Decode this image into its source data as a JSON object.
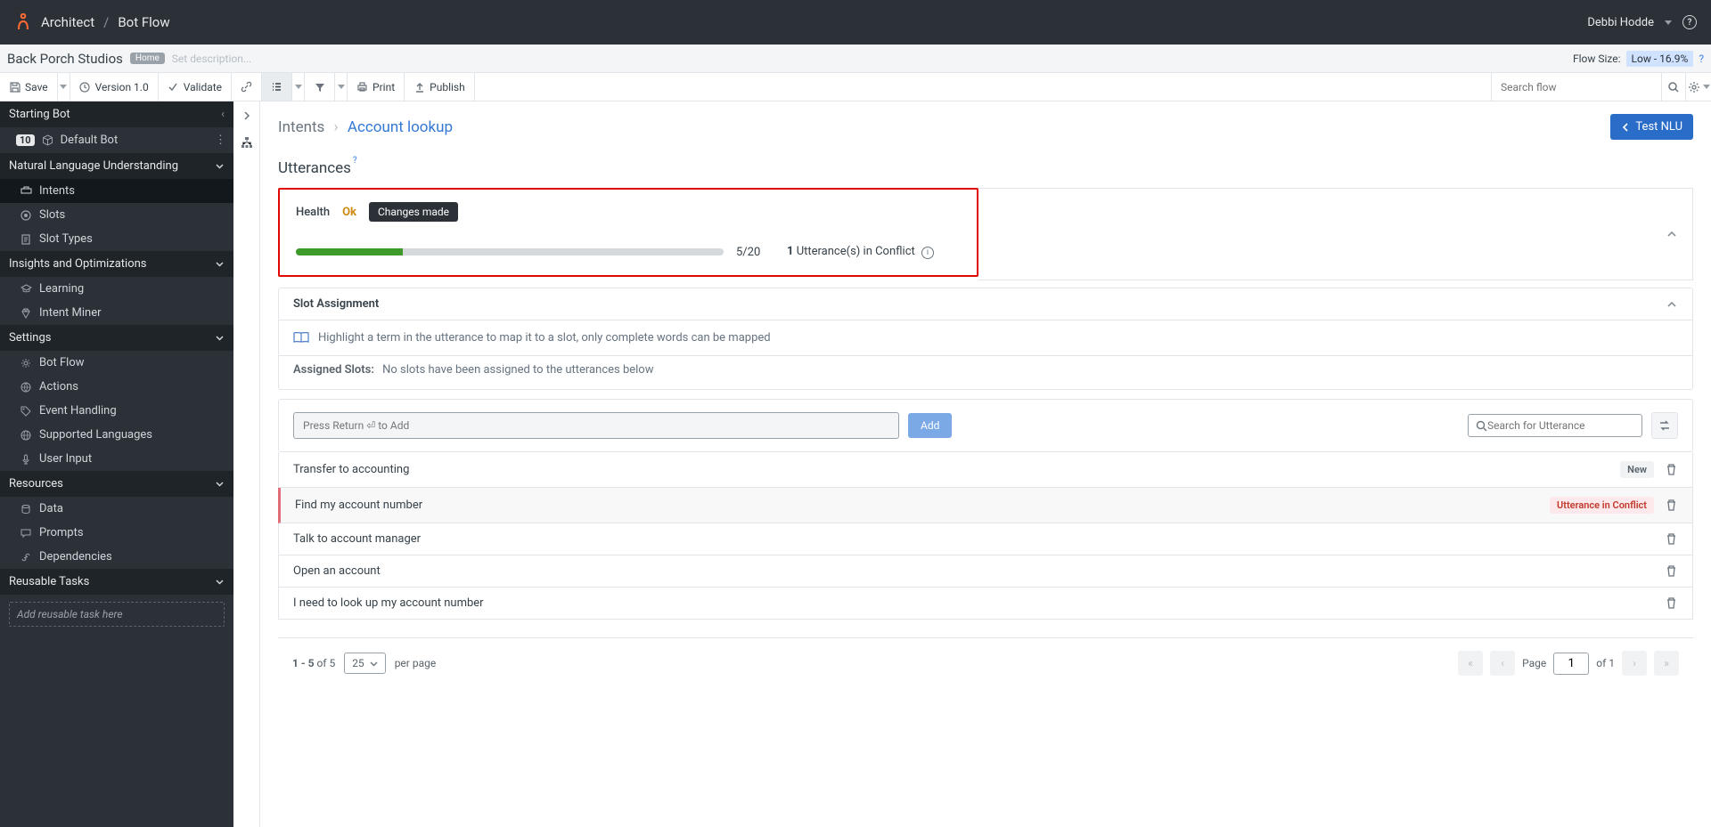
{
  "header": {
    "app": "Architect",
    "page": "Bot Flow",
    "user": "Debbi Hodde"
  },
  "subheader": {
    "flow_name": "Back Porch Studios",
    "home_badge": "Home",
    "desc_placeholder": "Set description...",
    "flow_size_label": "Flow Size:",
    "flow_size_value": "Low - 16.9%"
  },
  "toolbar": {
    "save": "Save",
    "version": "Version 1.0",
    "validate": "Validate",
    "print": "Print",
    "publish": "Publish",
    "search_placeholder": "Search flow"
  },
  "sidebar": {
    "starting_header": "Starting Bot",
    "starting_count": "10",
    "default_bot": "Default Bot",
    "nlu_header": "Natural Language Understanding",
    "nlu_items": [
      {
        "label": "Intents"
      },
      {
        "label": "Slots"
      },
      {
        "label": "Slot Types"
      }
    ],
    "insights_header": "Insights and Optimizations",
    "insights_items": [
      {
        "label": "Learning"
      },
      {
        "label": "Intent Miner"
      }
    ],
    "settings_header": "Settings",
    "settings_items": [
      {
        "label": "Bot Flow"
      },
      {
        "label": "Actions"
      },
      {
        "label": "Event Handling"
      },
      {
        "label": "Supported Languages"
      },
      {
        "label": "User Input"
      }
    ],
    "resources_header": "Resources",
    "resources_items": [
      {
        "label": "Data"
      },
      {
        "label": "Prompts"
      },
      {
        "label": "Dependencies"
      }
    ],
    "reusable_header": "Reusable Tasks",
    "reusable_placeholder": "Add reusable task here"
  },
  "main": {
    "breadcrumb_root": "Intents",
    "breadcrumb_current": "Account lookup",
    "test_btn": "Test NLU",
    "section_title": "Utterances",
    "health": {
      "label": "Health",
      "status": "Ok",
      "changes": "Changes made",
      "progress_text": "5/20",
      "progress_pct": 25,
      "conflict_count": "1",
      "conflict_text": " Utterance(s) in Conflict"
    },
    "slot": {
      "header": "Slot Assignment",
      "hint": "Highlight a term in the utterance to map it to a slot, only complete words can be mapped",
      "assigned_label": "Assigned Slots:",
      "assigned_value": "No slots have been assigned to the utterances below"
    },
    "add": {
      "input_placeholder": "Press Return ⏎ to Add",
      "add_btn": "Add",
      "search_placeholder": "Search for Utterance"
    },
    "utterances": [
      {
        "text": "Transfer to accounting",
        "badge": "New"
      },
      {
        "text": "Find my account number",
        "badge": "Utterance in Conflict",
        "conflict": true
      },
      {
        "text": "Talk to account manager"
      },
      {
        "text": "Open an account"
      },
      {
        "text": "I need to look up my account number"
      }
    ],
    "pager": {
      "range": "1 - 5",
      "of_label": " of ",
      "total": "5",
      "page_size": "25",
      "per_page": "per page",
      "page_label": "Page",
      "page_num": "1",
      "of_pages_label": "of ",
      "total_pages": "1"
    }
  }
}
